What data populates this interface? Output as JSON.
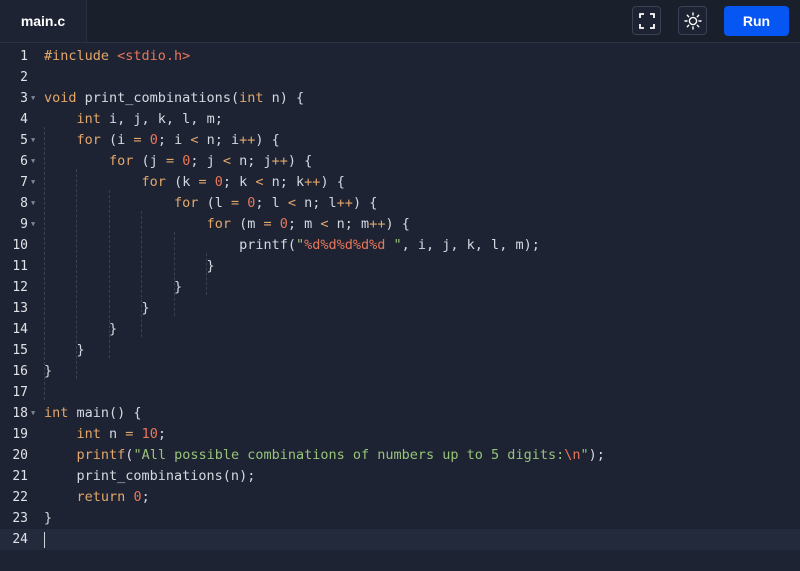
{
  "tab": {
    "filename": "main.c"
  },
  "toolbar": {
    "fullscreen_icon": "fullscreen-icon",
    "theme_icon": "sun-icon",
    "run_label": "Run",
    "accent_color": "#0556f3"
  },
  "editor": {
    "active_line": 24,
    "lines": [
      {
        "n": "1",
        "fold": false,
        "tokens": [
          [
            "pre",
            "#include "
          ],
          [
            "hdr",
            "<stdio.h>"
          ]
        ]
      },
      {
        "n": "2",
        "fold": false,
        "tokens": []
      },
      {
        "n": "3",
        "fold": true,
        "tokens": [
          [
            "kw",
            "void"
          ],
          [
            "plain",
            " print_combinations("
          ],
          [
            "kw",
            "int"
          ],
          [
            "plain",
            " n) {"
          ]
        ]
      },
      {
        "n": "4",
        "fold": false,
        "tokens": [
          [
            "plain",
            "    "
          ],
          [
            "kw",
            "int"
          ],
          [
            "plain",
            " i, j, k, l, m;"
          ]
        ]
      },
      {
        "n": "5",
        "fold": true,
        "tokens": [
          [
            "plain",
            "    "
          ],
          [
            "kw",
            "for"
          ],
          [
            "plain",
            " (i "
          ],
          [
            "op",
            "="
          ],
          [
            "plain",
            " "
          ],
          [
            "num",
            "0"
          ],
          [
            "plain",
            "; i "
          ],
          [
            "op",
            "<"
          ],
          [
            "plain",
            " n; i"
          ],
          [
            "op",
            "++"
          ],
          [
            "plain",
            ") {"
          ]
        ]
      },
      {
        "n": "6",
        "fold": true,
        "tokens": [
          [
            "plain",
            "        "
          ],
          [
            "kw",
            "for"
          ],
          [
            "plain",
            " (j "
          ],
          [
            "op",
            "="
          ],
          [
            "plain",
            " "
          ],
          [
            "num",
            "0"
          ],
          [
            "plain",
            "; j "
          ],
          [
            "op",
            "<"
          ],
          [
            "plain",
            " n; j"
          ],
          [
            "op",
            "++"
          ],
          [
            "plain",
            ") {"
          ]
        ]
      },
      {
        "n": "7",
        "fold": true,
        "tokens": [
          [
            "plain",
            "            "
          ],
          [
            "kw",
            "for"
          ],
          [
            "plain",
            " (k "
          ],
          [
            "op",
            "="
          ],
          [
            "plain",
            " "
          ],
          [
            "num",
            "0"
          ],
          [
            "plain",
            "; k "
          ],
          [
            "op",
            "<"
          ],
          [
            "plain",
            " n; k"
          ],
          [
            "op",
            "++"
          ],
          [
            "plain",
            ") {"
          ]
        ]
      },
      {
        "n": "8",
        "fold": true,
        "tokens": [
          [
            "plain",
            "                "
          ],
          [
            "kw",
            "for"
          ],
          [
            "plain",
            " (l "
          ],
          [
            "op",
            "="
          ],
          [
            "plain",
            " "
          ],
          [
            "num",
            "0"
          ],
          [
            "plain",
            "; l "
          ],
          [
            "op",
            "<"
          ],
          [
            "plain",
            " n; l"
          ],
          [
            "op",
            "++"
          ],
          [
            "plain",
            ") {"
          ]
        ]
      },
      {
        "n": "9",
        "fold": true,
        "tokens": [
          [
            "plain",
            "                    "
          ],
          [
            "kw",
            "for"
          ],
          [
            "plain",
            " (m "
          ],
          [
            "op",
            "="
          ],
          [
            "plain",
            " "
          ],
          [
            "num",
            "0"
          ],
          [
            "plain",
            "; m "
          ],
          [
            "op",
            "<"
          ],
          [
            "plain",
            " n; m"
          ],
          [
            "op",
            "++"
          ],
          [
            "plain",
            ") {"
          ]
        ]
      },
      {
        "n": "10",
        "fold": false,
        "tokens": [
          [
            "plain",
            "                        printf("
          ],
          [
            "str",
            "\""
          ],
          [
            "fmt",
            "%d%d%d%d%d "
          ],
          [
            "str",
            "\""
          ],
          [
            "plain",
            ", i, j, k, l, m);"
          ]
        ]
      },
      {
        "n": "11",
        "fold": false,
        "tokens": [
          [
            "plain",
            "                    }"
          ]
        ]
      },
      {
        "n": "12",
        "fold": false,
        "tokens": [
          [
            "plain",
            "                }"
          ]
        ]
      },
      {
        "n": "13",
        "fold": false,
        "tokens": [
          [
            "plain",
            "            }"
          ]
        ]
      },
      {
        "n": "14",
        "fold": false,
        "tokens": [
          [
            "plain",
            "        }"
          ]
        ]
      },
      {
        "n": "15",
        "fold": false,
        "tokens": [
          [
            "plain",
            "    }"
          ]
        ]
      },
      {
        "n": "16",
        "fold": false,
        "tokens": [
          [
            "plain",
            "}"
          ]
        ]
      },
      {
        "n": "17",
        "fold": false,
        "tokens": []
      },
      {
        "n": "18",
        "fold": true,
        "tokens": [
          [
            "kw",
            "int"
          ],
          [
            "plain",
            " main() {"
          ]
        ]
      },
      {
        "n": "19",
        "fold": false,
        "tokens": [
          [
            "plain",
            "    "
          ],
          [
            "kw",
            "int"
          ],
          [
            "plain",
            " n "
          ],
          [
            "op",
            "="
          ],
          [
            "plain",
            " "
          ],
          [
            "num",
            "10"
          ],
          [
            "plain",
            ";"
          ]
        ]
      },
      {
        "n": "20",
        "fold": false,
        "tokens": [
          [
            "plain",
            "    "
          ],
          [
            "kw",
            "printf"
          ],
          [
            "plain",
            "("
          ],
          [
            "str",
            "\"All possible combinations of numbers up to 5 digits:"
          ],
          [
            "fmt",
            "\\n"
          ],
          [
            "str",
            "\""
          ],
          [
            "plain",
            ");"
          ]
        ]
      },
      {
        "n": "21",
        "fold": false,
        "tokens": [
          [
            "plain",
            "    print_combinations(n);"
          ]
        ]
      },
      {
        "n": "22",
        "fold": false,
        "tokens": [
          [
            "plain",
            "    "
          ],
          [
            "kw",
            "return"
          ],
          [
            "plain",
            " "
          ],
          [
            "num",
            "0"
          ],
          [
            "plain",
            ";"
          ]
        ]
      },
      {
        "n": "23",
        "fold": false,
        "tokens": [
          [
            "plain",
            "}"
          ]
        ]
      },
      {
        "n": "24",
        "fold": false,
        "tokens": []
      }
    ]
  }
}
